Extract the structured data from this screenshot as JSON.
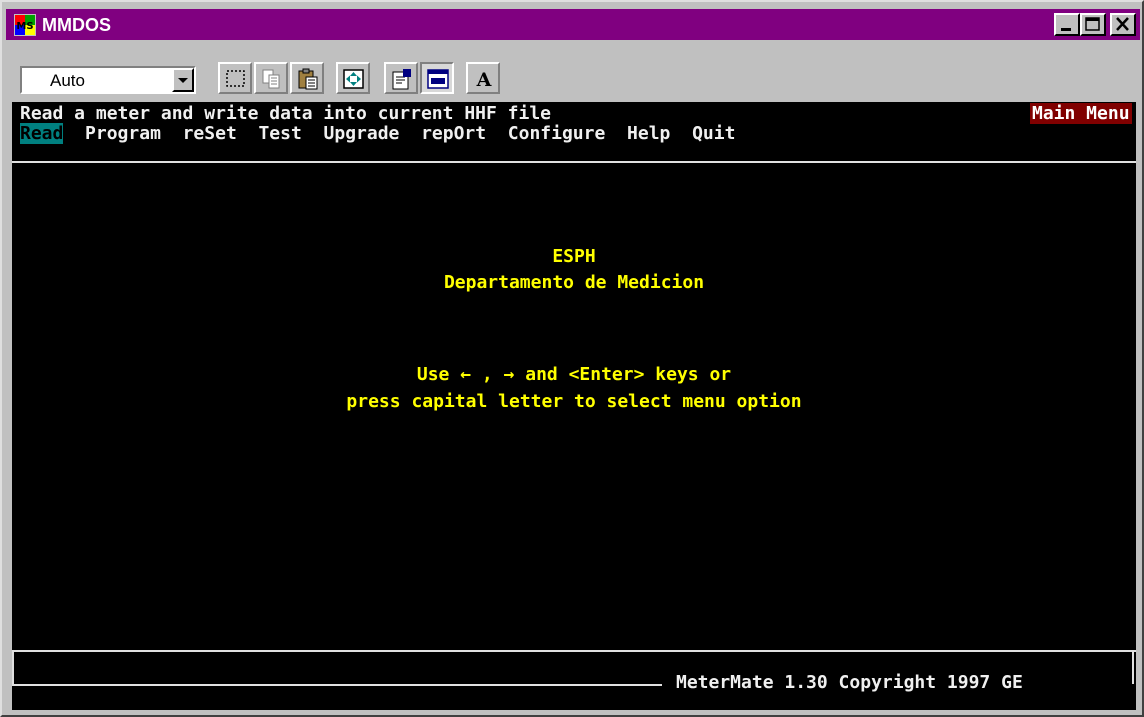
{
  "window": {
    "title": "MMDOS",
    "controls": [
      "minimize",
      "maximize",
      "close"
    ]
  },
  "toolbar": {
    "font_select_value": "Auto",
    "buttons": [
      "mark-icon",
      "copy-icon",
      "paste-icon",
      "fullscreen-icon",
      "properties-icon",
      "background-icon",
      "font-icon"
    ],
    "font_button_label": "A"
  },
  "console": {
    "status_line": "Read a meter and write data into current HHF file",
    "menu_badge": "Main Menu",
    "menu": [
      {
        "label": "Read",
        "selected": true
      },
      {
        "label": "Program",
        "selected": false
      },
      {
        "label": "reSet",
        "selected": false
      },
      {
        "label": "Test",
        "selected": false
      },
      {
        "label": "Upgrade",
        "selected": false
      },
      {
        "label": "repOrt",
        "selected": false
      },
      {
        "label": "Configure",
        "selected": false
      },
      {
        "label": "Help",
        "selected": false
      },
      {
        "label": "Quit",
        "selected": false
      }
    ],
    "org_line1": "ESPH",
    "org_line2": "Departamento de Medicion",
    "hint_line1": "Use ← , → and <Enter> keys or",
    "hint_line2": "press capital letter to select menu option",
    "footer": "MeterMate 1.30 Copyright 1997 GE"
  },
  "colors": {
    "titlebar": "#800080",
    "console_bg": "#000000",
    "text_yellow": "#ffff00",
    "badge_bg": "#800000",
    "menu_selected_bg": "#008080"
  }
}
